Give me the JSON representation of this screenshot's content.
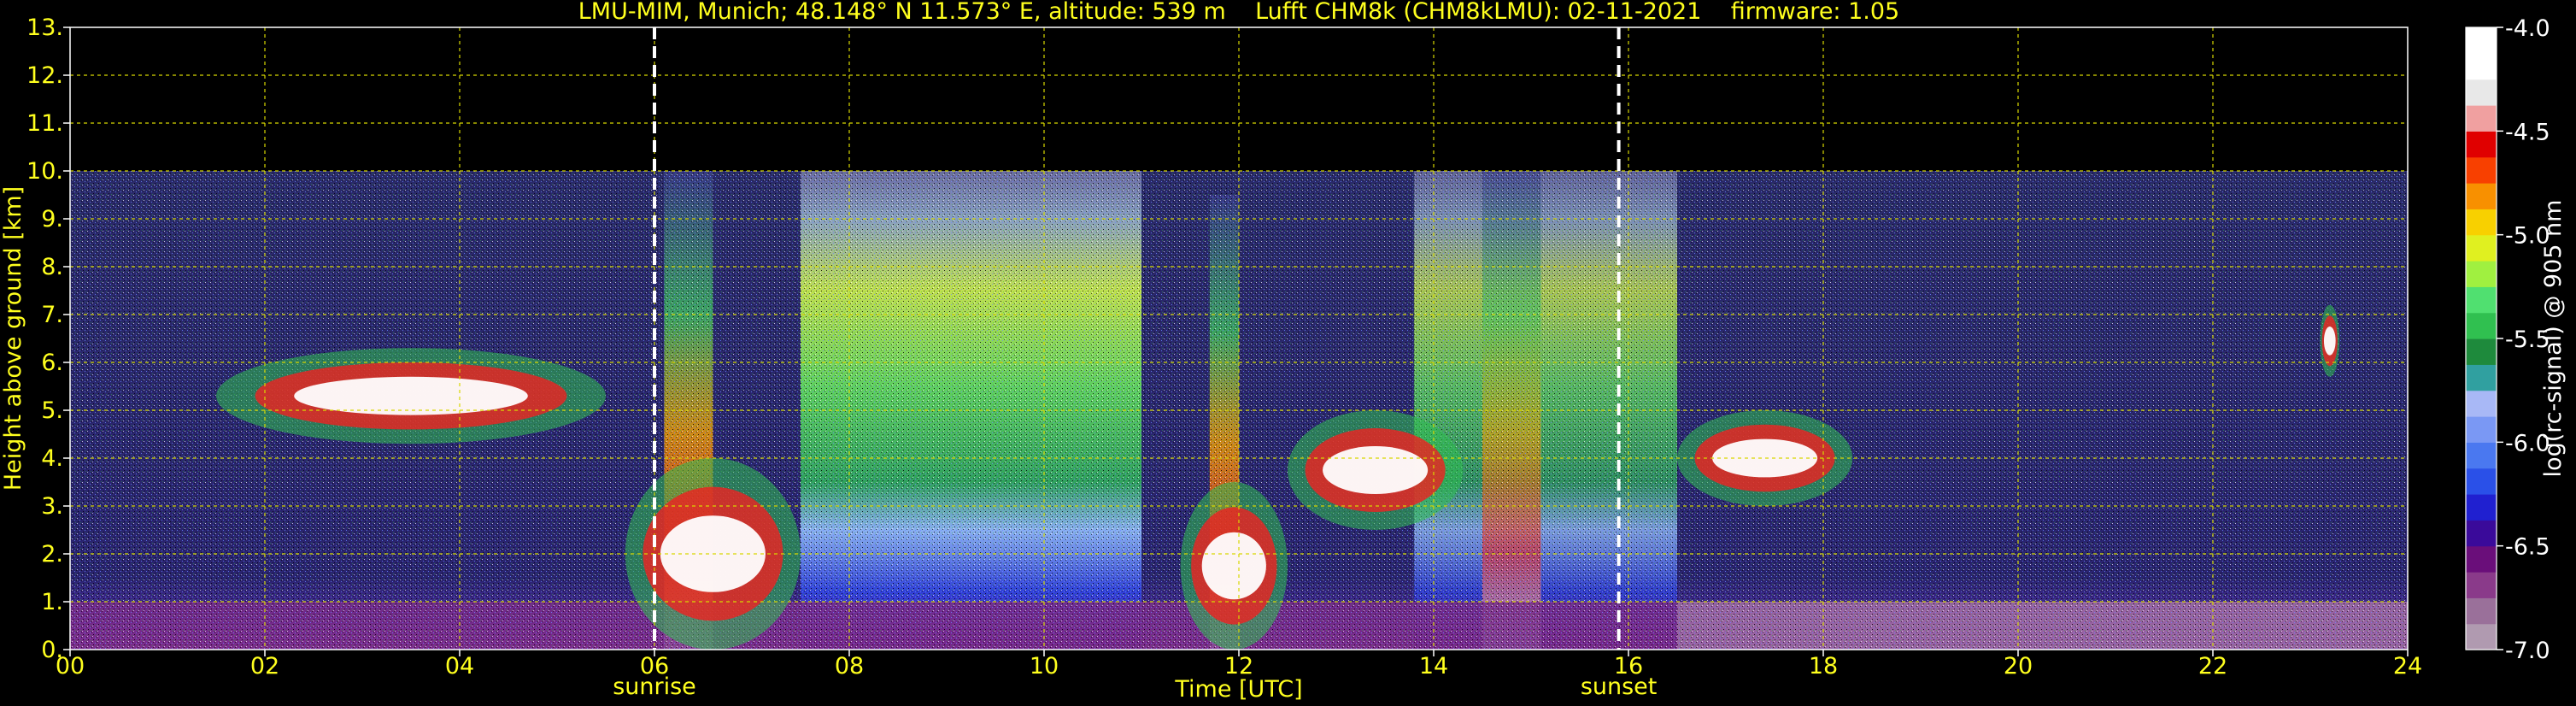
{
  "chart_data": {
    "type": "heatmap",
    "title": "LMU-MIM, Munich; 48.148° N 11.573° E, altitude: 539 m    Lufft CHM8k (CHM8kLMU): 02-11-2021    firmware: 1.05",
    "xlabel": "Time [UTC]",
    "ylabel": "Height above ground [km]",
    "xlim": [
      0,
      24
    ],
    "ylim": [
      0,
      13
    ],
    "x_ticks": [
      "00",
      "02",
      "04",
      "06",
      "08",
      "10",
      "12",
      "14",
      "16",
      "18",
      "20",
      "22",
      "24"
    ],
    "y_ticks": [
      "0.",
      "1.",
      "2.",
      "3.",
      "4.",
      "5.",
      "6.",
      "7.",
      "8.",
      "9.",
      "10.",
      "11.",
      "12.",
      "13."
    ],
    "grid": true,
    "data_top_km": 10,
    "events": [
      {
        "label": "sunrise",
        "x": 6.0
      },
      {
        "label": "sunset",
        "x": 15.9
      }
    ],
    "colorbar": {
      "label": "log(rc-signal) @ 905 nm",
      "range": [
        -7.0,
        -4.0
      ],
      "ticks": [
        "-4.0",
        "-4.5",
        "-5.0",
        "-5.5",
        "-6.0",
        "-6.5",
        "-7.0"
      ],
      "colors": [
        "#b09ab0",
        "#9a709a",
        "#8a3a8a",
        "#6a0e7a",
        "#3a0a9a",
        "#2020d0",
        "#2a50e8",
        "#4a78f0",
        "#7a98f4",
        "#a8b8f6",
        "#30a0a0",
        "#1e8a3c",
        "#30c050",
        "#50e070",
        "#a0f040",
        "#e0f020",
        "#f8d000",
        "#f89000",
        "#f84000",
        "#e00000",
        "#f0a0a0",
        "#e8e8e8",
        "#ffffff",
        "#ffffff"
      ]
    },
    "features": [
      {
        "name": "surface layer",
        "x": [
          0,
          24
        ],
        "y": [
          0,
          1.0
        ]
      },
      {
        "name": "mixing layer",
        "x": [
          7.5,
          11.0
        ],
        "y": [
          0,
          3.5
        ]
      },
      {
        "name": "cloud layer",
        "x": [
          1.5,
          5.5
        ],
        "y": [
          4.3,
          6.3
        ]
      },
      {
        "name": "low clouds",
        "x": [
          5.7,
          7.5
        ],
        "y": [
          0,
          4.0
        ]
      },
      {
        "name": "low clouds",
        "x": [
          11.4,
          12.5
        ],
        "y": [
          0,
          3.5
        ]
      },
      {
        "name": "cloud layer",
        "x": [
          12.5,
          14.3
        ],
        "y": [
          2.5,
          5.0
        ]
      },
      {
        "name": "cloud layer",
        "x": [
          16.5,
          18.3
        ],
        "y": [
          3.0,
          5.0
        ]
      },
      {
        "name": "thin cloud",
        "x": [
          23.1,
          23.3
        ],
        "y": [
          5.7,
          7.2
        ]
      }
    ]
  }
}
